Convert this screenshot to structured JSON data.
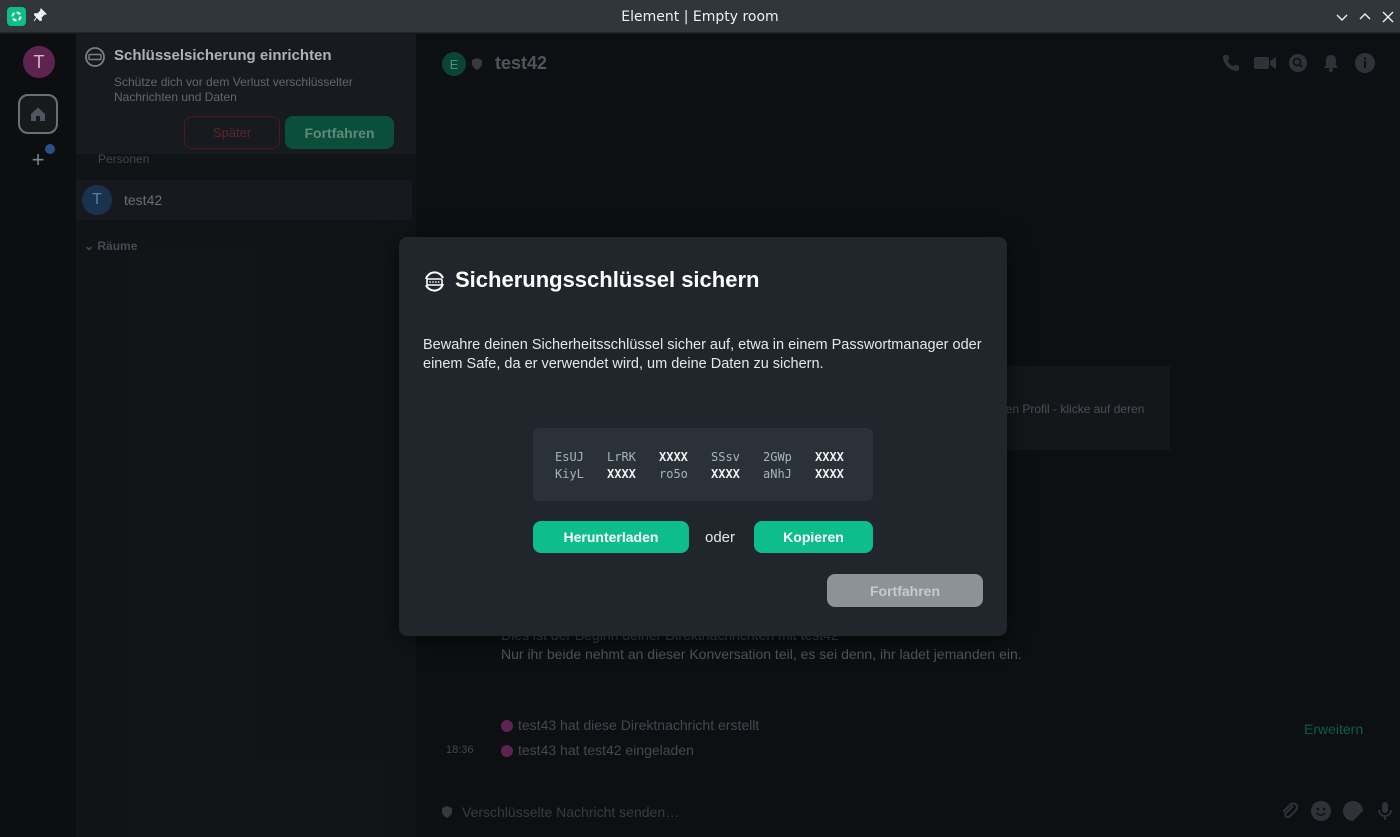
{
  "window": {
    "title": "Element | Empty room"
  },
  "spaces": {
    "user_initial": "T",
    "plus": "+"
  },
  "toast": {
    "title": "Schlüsselsicherung einrichten",
    "description": "Schütze dich vor dem Verlust verschlüsselter Nachrichten und Daten",
    "later_label": "Später",
    "continue_label": "Fortfahren"
  },
  "roomlist": {
    "people_section": "Personen",
    "rooms_section": "Räume",
    "room": {
      "initial": "T",
      "name": "test42"
    }
  },
  "room_header": {
    "initial": "E",
    "name": "test42"
  },
  "timeline": {
    "tooltip_fragment": "nen Profil - klicke auf deren",
    "intro_line1": "Dies ist der Beginn deiner Direktnachrichten mit test42",
    "intro_line2": "Nur ihr beide nehmt an dieser Konversation teil, es sei denn, ihr ladet jemanden ein.",
    "event1": "test43 hat diese Direktnachricht erstellt",
    "event2": "test43 hat test42 eingeladen",
    "time": "18:36",
    "expand_label": "Erweitern"
  },
  "composer": {
    "placeholder": "Verschlüsselte Nachricht senden…"
  },
  "dialog": {
    "title": "Sicherungsschlüssel sichern",
    "description": "Bewahre deinen Sicherheitsschlüssel sicher auf, etwa in einem Passwortmanager oder einem Safe, da er verwendet wird, um deine Daten zu sichern.",
    "key_row1": [
      "EsUJ",
      "LrRK",
      "XXXX",
      "SSsv",
      "2GWp",
      "XXXX"
    ],
    "key_row2": [
      "KiyL",
      "XXXX",
      "ro5o",
      "XXXX",
      "aNhJ",
      "XXXX"
    ],
    "download_label": "Herunterladen",
    "or_label": "oder",
    "copy_label": "Kopieren",
    "continue_label": "Fortfahren"
  },
  "colors": {
    "accent": "#0dbd8b",
    "dialog_bg": "#21262c",
    "danger": "#5a1e22"
  }
}
